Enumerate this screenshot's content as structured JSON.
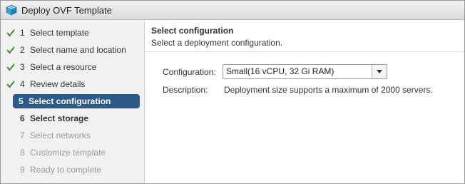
{
  "window": {
    "title": "Deploy OVF Template",
    "icon": "vapp-cube-icon"
  },
  "steps": [
    {
      "num": "1",
      "label": "Select template",
      "state": "done"
    },
    {
      "num": "2",
      "label": "Select name and location",
      "state": "done"
    },
    {
      "num": "3",
      "label": "Select a resource",
      "state": "done"
    },
    {
      "num": "4",
      "label": "Review details",
      "state": "done"
    },
    {
      "num": "5",
      "label": "Select configuration",
      "state": "active"
    },
    {
      "num": "6",
      "label": "Select storage",
      "state": "next"
    },
    {
      "num": "7",
      "label": "Select networks",
      "state": "pending"
    },
    {
      "num": "8",
      "label": "Customize template",
      "state": "pending"
    },
    {
      "num": "9",
      "label": "Ready to complete",
      "state": "pending"
    }
  ],
  "main": {
    "title": "Select configuration",
    "subtitle": "Select a deployment configuration.",
    "config_label": "Configuration:",
    "config_value": "Small(16 vCPU, 32 Gi RAM)",
    "description_label": "Description:",
    "description_value": "Deployment size supports a maximum of 2000 servers."
  },
  "colors": {
    "active_step_bg": "#2d5a86",
    "check_green": "#3a8a2a",
    "pending_text": "#9a9a9a"
  }
}
